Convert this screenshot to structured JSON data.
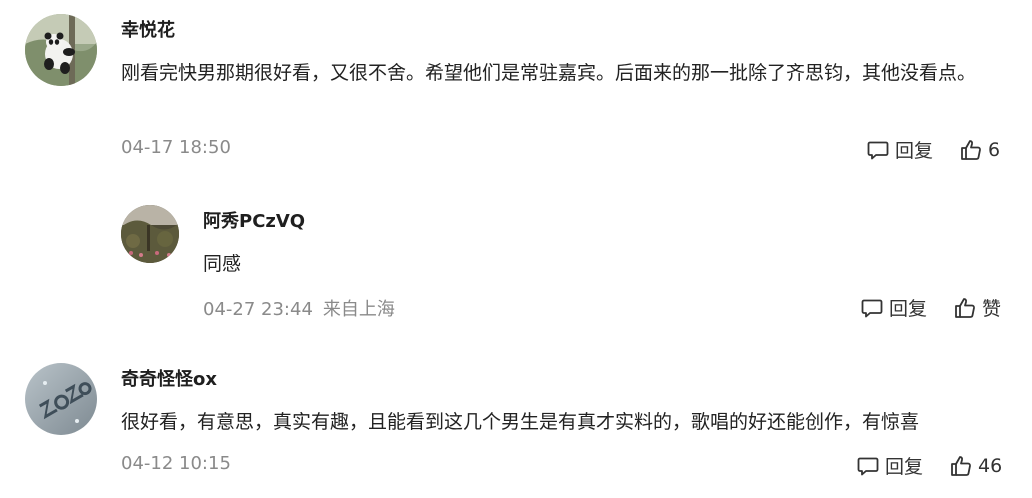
{
  "comments": [
    {
      "user": "幸悦花",
      "text": "刚看完快男那期很好看，又很不舍。希望他们是常驻嘉宾。后面来的那一批除了齐思钧，其他没看点。",
      "time": "04-17 18:50",
      "reply_label": "回复",
      "like_count": "6",
      "avatar_icon": "panda-avatar",
      "replies": [
        {
          "user": "阿秀PCzVQ",
          "text": "同感",
          "time": "04-27 23:44",
          "location": "来自上海",
          "reply_label": "回复",
          "like_label": "赞",
          "avatar_icon": "garden-avatar"
        }
      ]
    },
    {
      "user": "奇奇怪怪ox",
      "text": "很好看，有意思，真实有趣，且能看到这几个男生是有真才实料的，歌唱的好还能创作，有惊喜",
      "time": "04-12 10:15",
      "reply_label": "回复",
      "like_count": "46",
      "avatar_icon": "zozo-logo-avatar"
    }
  ],
  "colors": {
    "meta_text": "#8a8a8a",
    "body_text": "#222222",
    "icon_stroke": "#333333"
  }
}
